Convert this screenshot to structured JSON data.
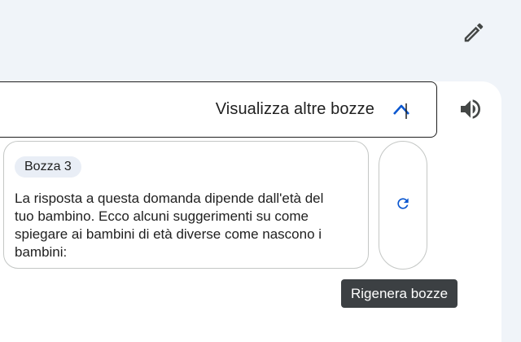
{
  "toolbar": {
    "edit_icon": "pencil-icon"
  },
  "drafts": {
    "toggle_label": "Visualizza altre bozze",
    "toggle_icon": "chevron-up-icon",
    "speaker_icon": "volume-icon",
    "card": {
      "chip": "Bozza 3",
      "text": "La risposta a questa domanda dipende dall'età del tuo bambino. Ecco alcuni suggerimenti su come spiegare ai bambini di età diverse come nascono i bambini:"
    },
    "regenerate_icon": "refresh-icon",
    "regenerate_tooltip": "Rigenera bozze"
  },
  "colors": {
    "accent": "#0b57d0",
    "tooltip_bg": "#3c4043",
    "border": "#c4c7c5"
  }
}
